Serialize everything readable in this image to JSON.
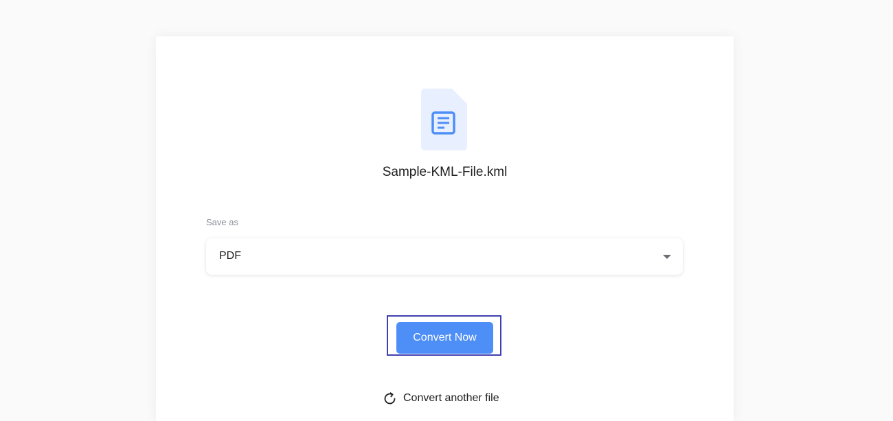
{
  "file": {
    "name": "Sample-KML-File.kml",
    "icon": "document-icon",
    "icon_bg_color": "#e8efff",
    "icon_color": "#4e8ef7"
  },
  "save_as": {
    "label": "Save as",
    "selected": "PDF"
  },
  "actions": {
    "convert_label": "Convert Now",
    "convert_another_label": "Convert another file",
    "accent_color": "#4e8ef7",
    "highlight_color": "#3f3fb0"
  }
}
